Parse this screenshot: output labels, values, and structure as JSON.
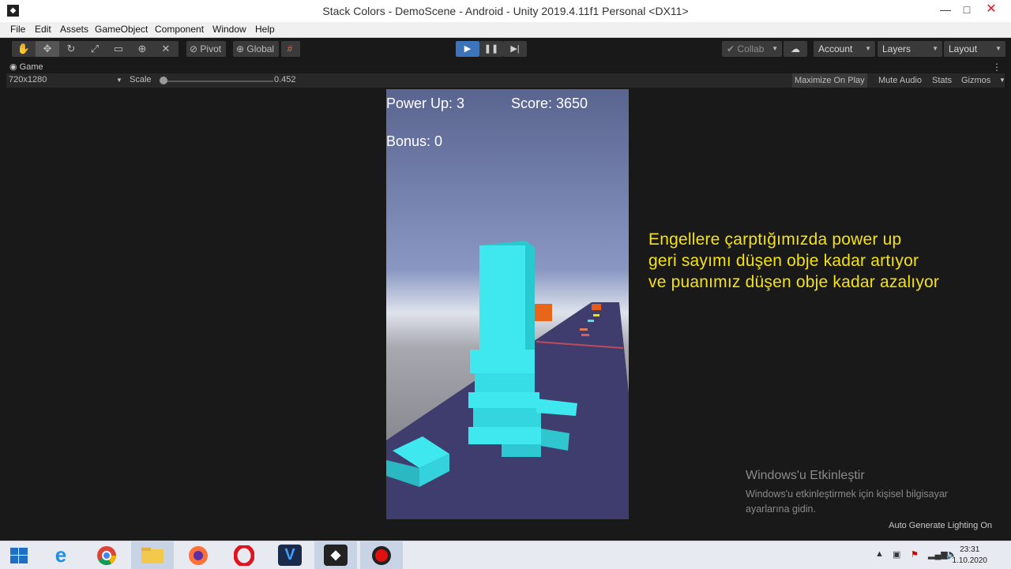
{
  "window": {
    "title": "Stack Colors - DemoScene - Android - Unity 2019.4.11f1 Personal <DX11>",
    "minimize_glyph": "—",
    "maximize_glyph": "□",
    "close_glyph": "✕"
  },
  "menu": [
    "File",
    "Edit",
    "Assets",
    "GameObject",
    "Component",
    "Window",
    "Help"
  ],
  "toolbar": {
    "tools": [
      {
        "name": "hand-tool",
        "glyph": "✋"
      },
      {
        "name": "move-tool",
        "glyph": "✥"
      },
      {
        "name": "rotate-tool",
        "glyph": "↻"
      },
      {
        "name": "scale-tool",
        "glyph": "⤢"
      },
      {
        "name": "rect-tool",
        "glyph": "▭"
      },
      {
        "name": "transform-tool",
        "glyph": "⊕"
      },
      {
        "name": "custom-tool",
        "glyph": "✕"
      }
    ],
    "pivot": "Pivot",
    "global": "Global",
    "grid_glyph": "#",
    "collab": "Collab",
    "account": "Account",
    "layers": "Layers",
    "layout": "Layout",
    "play_glyph": "▶",
    "pause_glyph": "❚❚",
    "step_glyph": "▶|",
    "cloud_glyph": "☁"
  },
  "game_tab": {
    "label": "Game",
    "resolution": "720x1280",
    "scale_label": "Scale",
    "scale_value": "0.452",
    "maximize_on_play": "Maximize On Play",
    "mute_audio": "Mute Audio",
    "stats": "Stats",
    "gizmos": "Gizmos"
  },
  "game": {
    "power_up": "Power Up: 3",
    "score": "Score: 3650",
    "bonus": "Bonus: 0"
  },
  "overlay": {
    "lines": [
      "Engellere çarptığımızda power up",
      "geri sayımı düşen obje kadar artıyor",
      "ve puanımız düşen obje kadar azalıyor"
    ]
  },
  "activation": {
    "title": "Windows'u Etkinleştir",
    "line1": "Windows'u etkinleştirmek için kişisel bilgisayar",
    "line2": "ayarlarına gidin."
  },
  "status": {
    "lighting": "Auto Generate Lighting On"
  },
  "taskbar": {
    "apps": [
      "start",
      "internet-explorer",
      "chrome",
      "file-explorer",
      "firefox",
      "opera",
      "visual-studio",
      "unity",
      "obs"
    ],
    "time": "23:31",
    "date": "1.10.2020"
  },
  "colors": {
    "overlay_text": "#f5e30a",
    "tower": "#3ee8ee",
    "play_active": "#3d73b8"
  }
}
